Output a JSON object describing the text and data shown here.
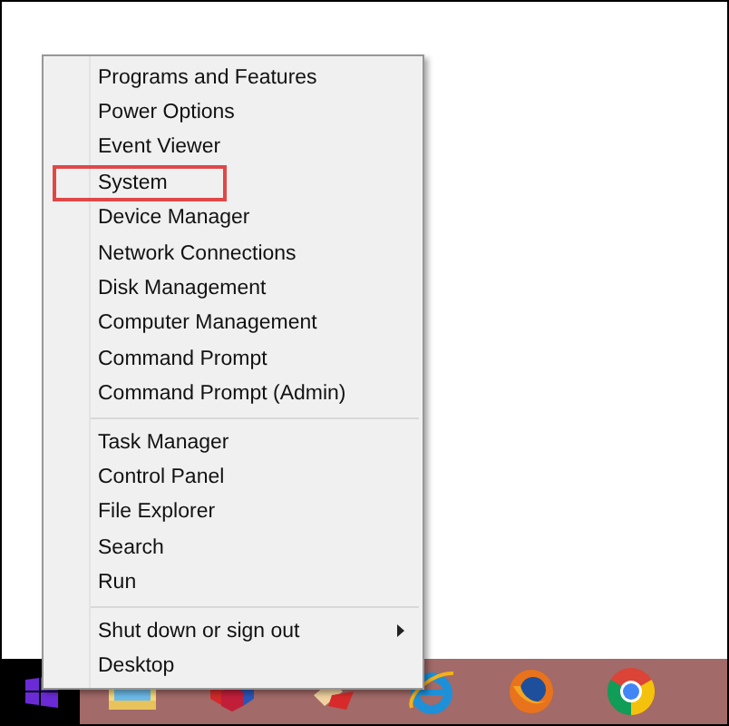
{
  "context_menu": {
    "groups": [
      {
        "items": [
          {
            "label": "Programs and Features",
            "highlighted": false,
            "submenu": false
          },
          {
            "label": "Power Options",
            "highlighted": false,
            "submenu": false
          },
          {
            "label": "Event Viewer",
            "highlighted": false,
            "submenu": false
          },
          {
            "label": "System",
            "highlighted": true,
            "submenu": false
          },
          {
            "label": "Device Manager",
            "highlighted": false,
            "submenu": false
          },
          {
            "label": "Network Connections",
            "highlighted": false,
            "submenu": false
          },
          {
            "label": "Disk Management",
            "highlighted": false,
            "submenu": false
          },
          {
            "label": "Computer Management",
            "highlighted": false,
            "submenu": false
          },
          {
            "label": "Command Prompt",
            "highlighted": false,
            "submenu": false
          },
          {
            "label": "Command Prompt (Admin)",
            "highlighted": false,
            "submenu": false
          }
        ]
      },
      {
        "items": [
          {
            "label": "Task Manager",
            "highlighted": false,
            "submenu": false
          },
          {
            "label": "Control Panel",
            "highlighted": false,
            "submenu": false
          },
          {
            "label": "File Explorer",
            "highlighted": false,
            "submenu": false
          },
          {
            "label": "Search",
            "highlighted": false,
            "submenu": false
          },
          {
            "label": "Run",
            "highlighted": false,
            "submenu": false
          }
        ]
      },
      {
        "items": [
          {
            "label": "Shut down or sign out",
            "highlighted": false,
            "submenu": true
          },
          {
            "label": "Desktop",
            "highlighted": false,
            "submenu": false
          }
        ]
      }
    ]
  }
}
